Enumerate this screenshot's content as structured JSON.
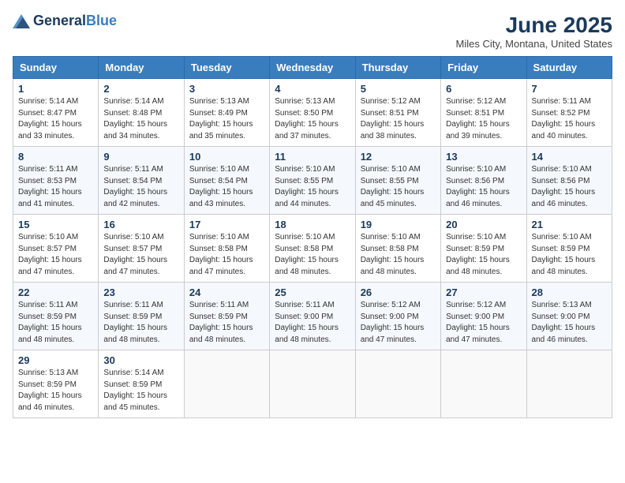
{
  "header": {
    "logo_general": "General",
    "logo_blue": "Blue",
    "month_title": "June 2025",
    "location": "Miles City, Montana, United States"
  },
  "weekdays": [
    "Sunday",
    "Monday",
    "Tuesday",
    "Wednesday",
    "Thursday",
    "Friday",
    "Saturday"
  ],
  "weeks": [
    [
      {
        "day": "1",
        "sunrise": "Sunrise: 5:14 AM",
        "sunset": "Sunset: 8:47 PM",
        "daylight": "Daylight: 15 hours and 33 minutes."
      },
      {
        "day": "2",
        "sunrise": "Sunrise: 5:14 AM",
        "sunset": "Sunset: 8:48 PM",
        "daylight": "Daylight: 15 hours and 34 minutes."
      },
      {
        "day": "3",
        "sunrise": "Sunrise: 5:13 AM",
        "sunset": "Sunset: 8:49 PM",
        "daylight": "Daylight: 15 hours and 35 minutes."
      },
      {
        "day": "4",
        "sunrise": "Sunrise: 5:13 AM",
        "sunset": "Sunset: 8:50 PM",
        "daylight": "Daylight: 15 hours and 37 minutes."
      },
      {
        "day": "5",
        "sunrise": "Sunrise: 5:12 AM",
        "sunset": "Sunset: 8:51 PM",
        "daylight": "Daylight: 15 hours and 38 minutes."
      },
      {
        "day": "6",
        "sunrise": "Sunrise: 5:12 AM",
        "sunset": "Sunset: 8:51 PM",
        "daylight": "Daylight: 15 hours and 39 minutes."
      },
      {
        "day": "7",
        "sunrise": "Sunrise: 5:11 AM",
        "sunset": "Sunset: 8:52 PM",
        "daylight": "Daylight: 15 hours and 40 minutes."
      }
    ],
    [
      {
        "day": "8",
        "sunrise": "Sunrise: 5:11 AM",
        "sunset": "Sunset: 8:53 PM",
        "daylight": "Daylight: 15 hours and 41 minutes."
      },
      {
        "day": "9",
        "sunrise": "Sunrise: 5:11 AM",
        "sunset": "Sunset: 8:54 PM",
        "daylight": "Daylight: 15 hours and 42 minutes."
      },
      {
        "day": "10",
        "sunrise": "Sunrise: 5:10 AM",
        "sunset": "Sunset: 8:54 PM",
        "daylight": "Daylight: 15 hours and 43 minutes."
      },
      {
        "day": "11",
        "sunrise": "Sunrise: 5:10 AM",
        "sunset": "Sunset: 8:55 PM",
        "daylight": "Daylight: 15 hours and 44 minutes."
      },
      {
        "day": "12",
        "sunrise": "Sunrise: 5:10 AM",
        "sunset": "Sunset: 8:55 PM",
        "daylight": "Daylight: 15 hours and 45 minutes."
      },
      {
        "day": "13",
        "sunrise": "Sunrise: 5:10 AM",
        "sunset": "Sunset: 8:56 PM",
        "daylight": "Daylight: 15 hours and 46 minutes."
      },
      {
        "day": "14",
        "sunrise": "Sunrise: 5:10 AM",
        "sunset": "Sunset: 8:56 PM",
        "daylight": "Daylight: 15 hours and 46 minutes."
      }
    ],
    [
      {
        "day": "15",
        "sunrise": "Sunrise: 5:10 AM",
        "sunset": "Sunset: 8:57 PM",
        "daylight": "Daylight: 15 hours and 47 minutes."
      },
      {
        "day": "16",
        "sunrise": "Sunrise: 5:10 AM",
        "sunset": "Sunset: 8:57 PM",
        "daylight": "Daylight: 15 hours and 47 minutes."
      },
      {
        "day": "17",
        "sunrise": "Sunrise: 5:10 AM",
        "sunset": "Sunset: 8:58 PM",
        "daylight": "Daylight: 15 hours and 47 minutes."
      },
      {
        "day": "18",
        "sunrise": "Sunrise: 5:10 AM",
        "sunset": "Sunset: 8:58 PM",
        "daylight": "Daylight: 15 hours and 48 minutes."
      },
      {
        "day": "19",
        "sunrise": "Sunrise: 5:10 AM",
        "sunset": "Sunset: 8:58 PM",
        "daylight": "Daylight: 15 hours and 48 minutes."
      },
      {
        "day": "20",
        "sunrise": "Sunrise: 5:10 AM",
        "sunset": "Sunset: 8:59 PM",
        "daylight": "Daylight: 15 hours and 48 minutes."
      },
      {
        "day": "21",
        "sunrise": "Sunrise: 5:10 AM",
        "sunset": "Sunset: 8:59 PM",
        "daylight": "Daylight: 15 hours and 48 minutes."
      }
    ],
    [
      {
        "day": "22",
        "sunrise": "Sunrise: 5:11 AM",
        "sunset": "Sunset: 8:59 PM",
        "daylight": "Daylight: 15 hours and 48 minutes."
      },
      {
        "day": "23",
        "sunrise": "Sunrise: 5:11 AM",
        "sunset": "Sunset: 8:59 PM",
        "daylight": "Daylight: 15 hours and 48 minutes."
      },
      {
        "day": "24",
        "sunrise": "Sunrise: 5:11 AM",
        "sunset": "Sunset: 8:59 PM",
        "daylight": "Daylight: 15 hours and 48 minutes."
      },
      {
        "day": "25",
        "sunrise": "Sunrise: 5:11 AM",
        "sunset": "Sunset: 9:00 PM",
        "daylight": "Daylight: 15 hours and 48 minutes."
      },
      {
        "day": "26",
        "sunrise": "Sunrise: 5:12 AM",
        "sunset": "Sunset: 9:00 PM",
        "daylight": "Daylight: 15 hours and 47 minutes."
      },
      {
        "day": "27",
        "sunrise": "Sunrise: 5:12 AM",
        "sunset": "Sunset: 9:00 PM",
        "daylight": "Daylight: 15 hours and 47 minutes."
      },
      {
        "day": "28",
        "sunrise": "Sunrise: 5:13 AM",
        "sunset": "Sunset: 9:00 PM",
        "daylight": "Daylight: 15 hours and 46 minutes."
      }
    ],
    [
      {
        "day": "29",
        "sunrise": "Sunrise: 5:13 AM",
        "sunset": "Sunset: 8:59 PM",
        "daylight": "Daylight: 15 hours and 46 minutes."
      },
      {
        "day": "30",
        "sunrise": "Sunrise: 5:14 AM",
        "sunset": "Sunset: 8:59 PM",
        "daylight": "Daylight: 15 hours and 45 minutes."
      },
      null,
      null,
      null,
      null,
      null
    ]
  ]
}
